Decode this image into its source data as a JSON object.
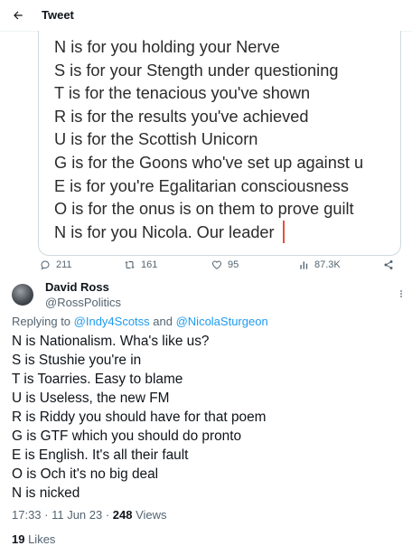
{
  "header": {
    "title": "Tweet",
    "back_icon": "arrow-left-icon"
  },
  "quoted_image": {
    "lines": [
      "N is for you holding your Nerve",
      "S is for your Stength under questioning",
      "T is for the tenacious you've shown",
      "R is for the results you've achieved",
      "U is for the Scottish Unicorn",
      "G is for the Goons who've set up against u",
      "E is for you're Egalitarian consciousness",
      "O is for the onus is on them to prove guilt",
      "N is for you Nicola. Our leader"
    ]
  },
  "actions": {
    "replies": "211",
    "retweets": "161",
    "likes": "95",
    "views": "87.3K"
  },
  "reply": {
    "author_name": "David Ross",
    "author_handle": "@RossPolitics",
    "replying_prefix": "Replying to ",
    "mention_1": "@Indy4Scotss",
    "mention_sep": " and ",
    "mention_2": "@NicolaSturgeon",
    "lines": [
      "N is Nationalism. Wha's like us?",
      "S is Stushie you're in",
      "T is Toarries. Easy to blame",
      "U is Useless, the new FM",
      "R is Riddy you should have for that poem",
      "G is GTF which you should do pronto",
      "E is English. It's all their fault",
      "O is Och it's no big deal",
      "N is nicked"
    ],
    "timestamp": "17:33 · 11 Jun 23 · ",
    "views_count": "248",
    "views_label": " Views",
    "likes_count": "19",
    "likes_label": " Likes"
  },
  "colors": {
    "accent": "#1d9bf0",
    "secondary_text": "#536471",
    "border": "#cfd9de",
    "cursor": "#e0533b"
  }
}
